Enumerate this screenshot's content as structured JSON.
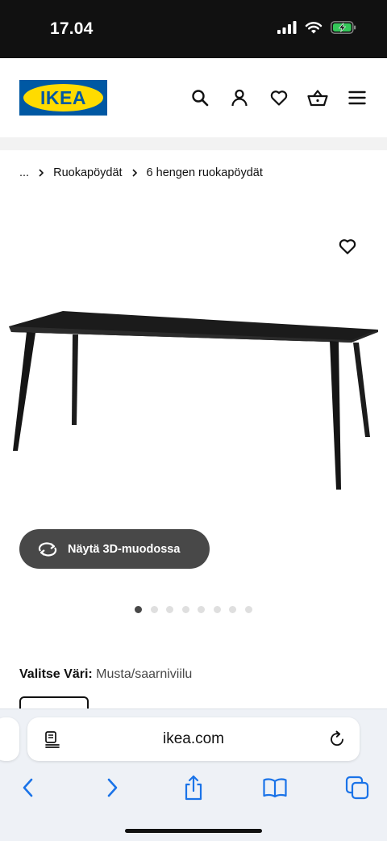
{
  "status_bar": {
    "time": "17.04"
  },
  "header": {
    "logo_text": "IKEA",
    "icons": [
      "search-icon",
      "account-icon",
      "favourites-icon",
      "cart-icon",
      "menu-icon"
    ]
  },
  "breadcrumb": {
    "items": [
      "...",
      "Ruokapöydät",
      "6 hengen ruokapöydät"
    ]
  },
  "product": {
    "view_3d_label": "Näytä 3D-muodossa",
    "carousel": {
      "count": 8,
      "active_index": 0
    }
  },
  "color_selection": {
    "label": "Valitse Väri:",
    "value": "Musta/saarniviilu"
  },
  "browser": {
    "url": "ikea.com"
  },
  "colors": {
    "ikea_blue": "#0058a3",
    "ikea_yellow": "#ffdb00",
    "button_dark": "#484848",
    "safari_blue": "#1a73e8"
  }
}
